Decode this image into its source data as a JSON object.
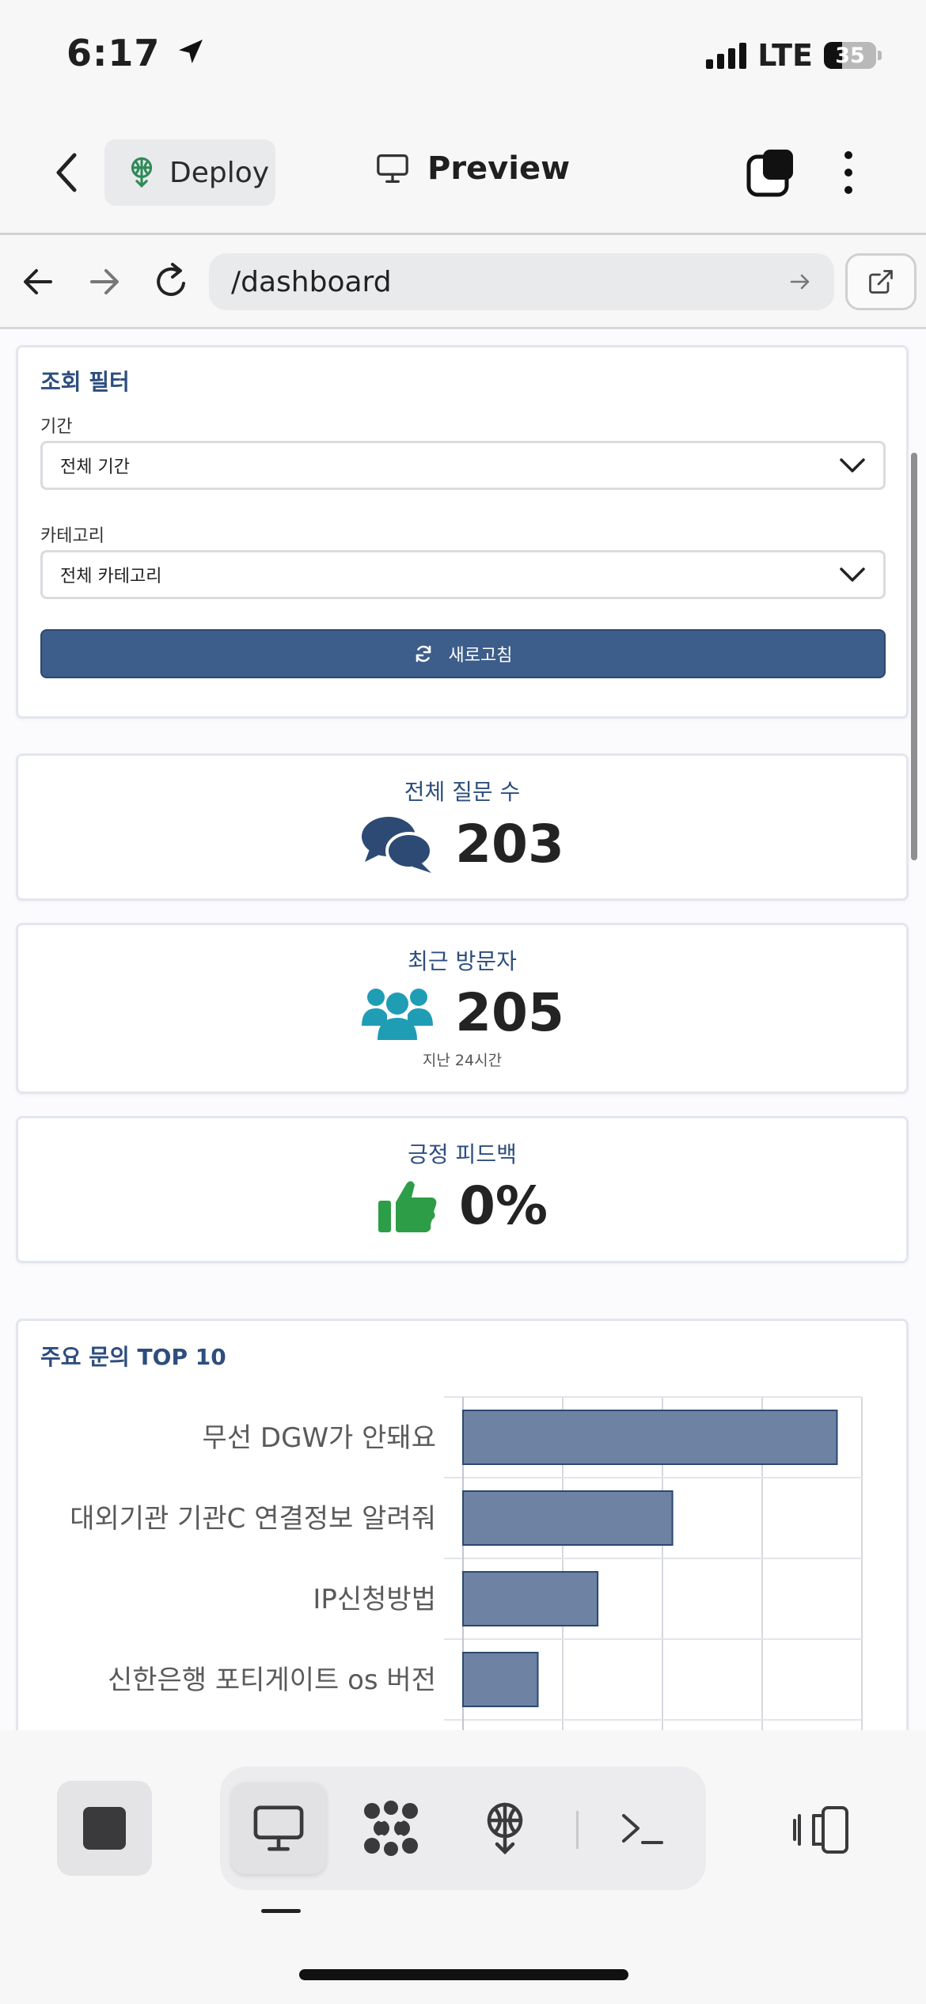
{
  "status_bar": {
    "time": "6:17",
    "network": "LTE",
    "battery": "35"
  },
  "app_bar": {
    "deploy_label": "Deploy",
    "preview_label": "Preview"
  },
  "url_bar": {
    "url": "/dashboard"
  },
  "filter": {
    "title": "조회 필터",
    "period_label": "기간",
    "period_value": "전체 기간",
    "category_label": "카테고리",
    "category_value": "전체 카테고리",
    "refresh_label": "새로고침"
  },
  "stats": {
    "questions": {
      "label": "전체 질문 수",
      "value": "203"
    },
    "visitors": {
      "label": "최근 방문자",
      "value": "205",
      "sub": "지난 24시간"
    },
    "feedback": {
      "label": "긍정 피드백",
      "value": "0%"
    }
  },
  "colors": {
    "accent": "#2d4e7e",
    "button": "#3d5d8a",
    "questions_icon": "#2c4a74",
    "visitors_icon": "#1f9db5",
    "feedback_icon": "#2e9d47",
    "bar_fill": "#6e82a3",
    "bar_stroke": "#2c4870"
  },
  "chart_data": {
    "type": "bar",
    "orientation": "horizontal",
    "title": "주요 문의 TOP 10",
    "categories": [
      "무선 DGW가 안돼요",
      "대외기관 기관C 연결정보 알려줘",
      "IP신청방법",
      "신한은행 포티게이트 os 버전"
    ],
    "values": [
      7.5,
      4.2,
      2.7,
      1.5
    ],
    "xlim": [
      0,
      8
    ],
    "grid": true
  },
  "toolbar": {
    "icons": [
      "stop-icon",
      "monitor-icon",
      "agents-icon",
      "deploy-icon",
      "terminal-icon",
      "device-icon"
    ]
  }
}
